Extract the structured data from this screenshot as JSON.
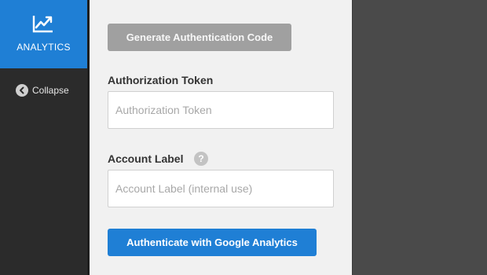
{
  "sidebar": {
    "analytics_label": "ANALYTICS",
    "analytics_icon": "chart-line-icon",
    "collapse_label": "Collapse",
    "collapse_icon": "arrow-left-circle-icon"
  },
  "form": {
    "generate_button": "Generate Authentication Code",
    "token_label": "Authorization Token",
    "token_placeholder": "Authorization Token",
    "token_value": "",
    "account_label": "Account Label",
    "account_help_icon": "question-icon",
    "account_placeholder": "Account Label (internal use)",
    "account_value": "",
    "authenticate_button": "Authenticate with Google Analytics"
  },
  "colors": {
    "accent": "#1f7fd5",
    "disabled_button": "#a0a0a0",
    "sidebar_bg": "#2b2b2b",
    "panel_bg": "#f1f1f1",
    "backdrop": "#4a4a4a"
  }
}
